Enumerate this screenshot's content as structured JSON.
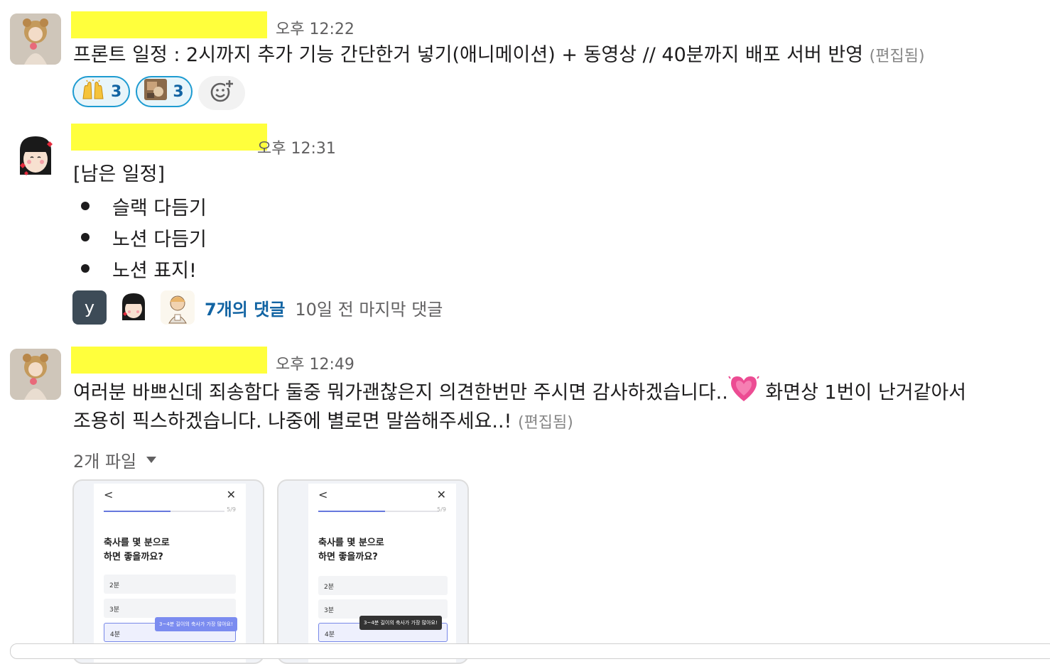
{
  "messages": [
    {
      "time": "오후 12:22",
      "text": "프론트 일정 : 2시까지 추가 기능 간단한거 넣기(애니메이션) + 동영상  // 40분까지 배포 서버 반영",
      "edited": "(편집됨)",
      "reactions": [
        {
          "icon": "raised-hands-icon",
          "count": "3"
        },
        {
          "icon": "custom-photo-emoji-icon",
          "count": "3"
        }
      ]
    },
    {
      "time": "오후 12:31",
      "heading": "[남은 일정]",
      "bullets": [
        "슬랙 다듬기",
        "노션 다듬기",
        "노션 표지!"
      ],
      "thread": {
        "avatar_letter": "y",
        "reply_count": "7개의 댓글",
        "last_reply": "10일 전 마지막 댓글"
      }
    },
    {
      "time": "오후 12:49",
      "line1_a": "여러분 바쁘신데 죄송함다 둘중 뭐가괜찮은지 의견한번만 주시면 감사하겠습니다..",
      "line1_b": " 화면상 1번이 난거같아서",
      "line2": "조용히 픽스하겠습니다. 나중에 별로면 말씀해주세요..!",
      "edited": "(편집됨)",
      "files_label": "2개 파일",
      "files": [
        {
          "step": "5/9",
          "question": "축사를 몇 분으로\n하면 좋을까요?",
          "options": [
            "2분",
            "3분",
            "4분"
          ],
          "progress": 0.55,
          "tooltip": "3~4분 길이의 축사가 가장 많아요!",
          "tooltip_color": "#7b8cf0"
        },
        {
          "step": "5/9",
          "question": "축사를 몇 분으로\n하면 좋을까요?",
          "options": [
            "2분",
            "3분",
            "4분"
          ],
          "progress": 0.55,
          "tooltip": "3~4분 길이의 축사가 가장 많아요!",
          "tooltip_color": "#333333"
        }
      ]
    }
  ],
  "colors": {
    "name_redaction": "#ffff3c",
    "link": "#1264a3",
    "reaction_border": "#1d9bd1"
  }
}
